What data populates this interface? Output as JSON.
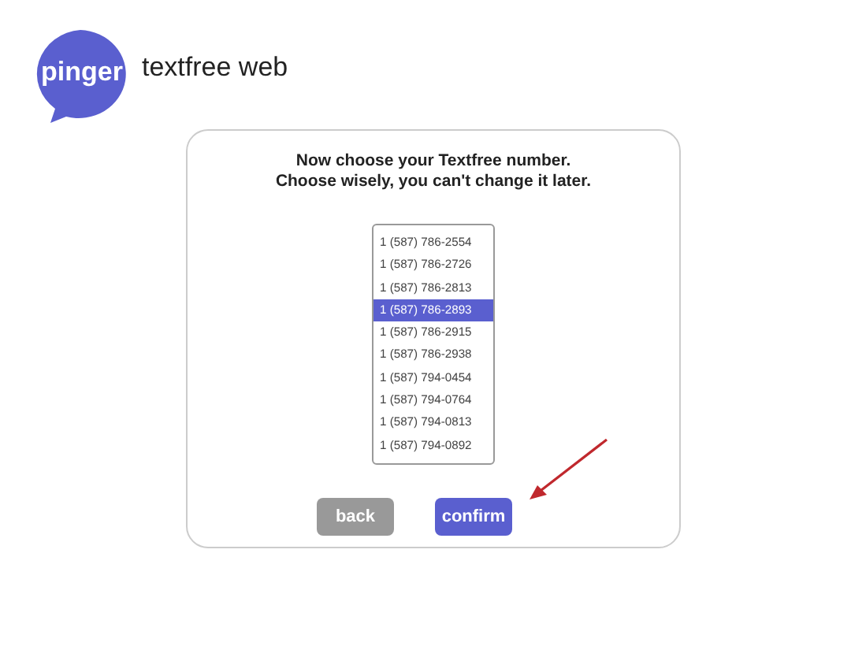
{
  "logo": {
    "brand": "pinger",
    "product": "textfree web"
  },
  "heading": [
    "Now choose your Textfree number.",
    "Choose wisely, you can't change it later."
  ],
  "numbers": [
    {
      "label": "1 (587) 786-2554",
      "selected": false
    },
    {
      "label": "1 (587) 786-2726",
      "selected": false
    },
    {
      "label": "1 (587) 786-2813",
      "selected": false
    },
    {
      "label": "1 (587) 786-2893",
      "selected": true
    },
    {
      "label": "1 (587) 786-2915",
      "selected": false
    },
    {
      "label": "1 (587) 786-2938",
      "selected": false
    },
    {
      "label": "1 (587) 794-0454",
      "selected": false
    },
    {
      "label": "1 (587) 794-0764",
      "selected": false
    },
    {
      "label": "1 (587) 794-0813",
      "selected": false
    },
    {
      "label": "1 (587) 794-0892",
      "selected": false
    }
  ],
  "buttons": [
    {
      "label": "back",
      "kind": "secondary"
    },
    {
      "label": "confirm",
      "kind": "primary"
    }
  ]
}
